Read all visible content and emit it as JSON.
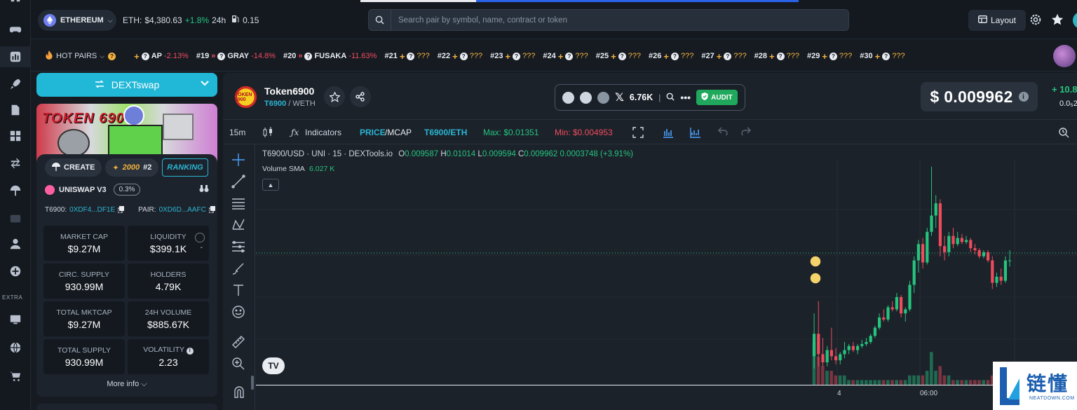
{
  "rail": {
    "extra_label": "EXTRA"
  },
  "topbar": {
    "chain": "ETHEREUM",
    "eth_label": "ETH:",
    "eth_price": "$4,380.63",
    "eth_change": "+1.8%",
    "eth_period": "24h",
    "gas": "0.15",
    "search_placeholder": "Search pair by symbol, name, contract or token",
    "layout_label": "Layout"
  },
  "ticker": {
    "hot_label": "HOT PAIRS",
    "items": [
      {
        "rank": "",
        "symbol": "AP",
        "change": "-2.13%"
      },
      {
        "rank": "#19",
        "symbol": "GRAY",
        "change": "-14.8%"
      },
      {
        "rank": "#20",
        "symbol": "FUSAKA",
        "change": "-11.63%"
      },
      {
        "rank": "#21",
        "symbol": "???",
        "change": ""
      },
      {
        "rank": "#22",
        "symbol": "???",
        "change": ""
      },
      {
        "rank": "#23",
        "symbol": "???",
        "change": ""
      },
      {
        "rank": "#24",
        "symbol": "???",
        "change": ""
      },
      {
        "rank": "#25",
        "symbol": "???",
        "change": ""
      },
      {
        "rank": "#26",
        "symbol": "???",
        "change": ""
      },
      {
        "rank": "#27",
        "symbol": "???",
        "change": ""
      },
      {
        "rank": "#28",
        "symbol": "???",
        "change": ""
      },
      {
        "rank": "#29",
        "symbol": "???",
        "change": ""
      },
      {
        "rank": "#30",
        "symbol": "???",
        "change": ""
      }
    ]
  },
  "left": {
    "swap_label": "DEXTswap",
    "banner_text": "TOKEN 6900",
    "create_label": "CREATE",
    "score": "2000",
    "score_rank": "#2",
    "ranking_label": "RANKING",
    "dex": "UNISWAP V3",
    "fee": "0.3%",
    "token_addr_label": "T6900:",
    "token_addr": "0XDF4...DF1E",
    "pair_addr_label": "PAIR:",
    "pair_addr": "0XD6D...AAFC",
    "stats": [
      {
        "label": "MARKET CAP",
        "value": "$9.27M"
      },
      {
        "label": "LIQUIDITY",
        "value": "$399.1K"
      },
      {
        "label": "CIRC. SUPPLY",
        "value": "930.99M"
      },
      {
        "label": "HOLDERS",
        "value": "4.79K"
      },
      {
        "label": "TOTAL MKTCAP",
        "value": "$9.27M"
      },
      {
        "label": "24H VOLUME",
        "value": "$885.67K"
      },
      {
        "label": "TOTAL SUPPLY",
        "value": "930.99M"
      },
      {
        "label": "VOLATILITY",
        "value": "2.23"
      }
    ],
    "liquidity_extra": "-",
    "more_info": "More info"
  },
  "token": {
    "name": "Token6900",
    "symbol": "T6900",
    "quote": "/ WETH",
    "x_followers": "6.76K",
    "audit_label": "AUDIT",
    "price": "$ 0.009962",
    "change_24h": "+ 10.8",
    "change_sub": "0.0₅2",
    "logo_text": "TOKEN 6900"
  },
  "toolbar": {
    "interval": "15m",
    "indicators": "Indicators",
    "price_label": "PRICE",
    "mcap_label": "/MCAP",
    "pair_label": "T6900/ETH",
    "max_label": "Max: $0.01351",
    "min_label": "Min: $0.004953"
  },
  "legend": {
    "series": "T6900/USD · UNI · 15 · DEXTools.io",
    "o_label": "O",
    "o": "0.009587",
    "h_label": "H",
    "h": "0.01014",
    "l_label": "L",
    "l": "0.009594",
    "c_label": "C",
    "c": "0.009962",
    "change": "0.0003748 (+3.91%)",
    "vol_label": "Volume SMA",
    "vol": "6.027 K"
  },
  "watermark": {
    "cn": "链懂",
    "en": "NEATDOWN.COM"
  },
  "chart_data": {
    "type": "candlestick",
    "x_tick_labels": [
      "4",
      "06:00"
    ],
    "last_price": 0.009962,
    "max": 0.01351,
    "min": 0.004953,
    "candles": [
      {
        "o": 0.0049,
        "h": 0.007,
        "l": 0.0043,
        "c": 0.006
      },
      {
        "o": 0.006,
        "h": 0.0076,
        "l": 0.0044,
        "c": 0.005
      },
      {
        "o": 0.005,
        "h": 0.0058,
        "l": 0.0044,
        "c": 0.0046
      },
      {
        "o": 0.0046,
        "h": 0.0054,
        "l": 0.0044,
        "c": 0.0052
      },
      {
        "o": 0.0052,
        "h": 0.0063,
        "l": 0.0047,
        "c": 0.0049
      },
      {
        "o": 0.0049,
        "h": 0.0053,
        "l": 0.0045,
        "c": 0.0047
      },
      {
        "o": 0.0047,
        "h": 0.0051,
        "l": 0.0045,
        "c": 0.005
      },
      {
        "o": 0.005,
        "h": 0.0056,
        "l": 0.0048,
        "c": 0.0052
      },
      {
        "o": 0.0052,
        "h": 0.0055,
        "l": 0.005,
        "c": 0.0054
      },
      {
        "o": 0.0054,
        "h": 0.0056,
        "l": 0.0051,
        "c": 0.0052
      },
      {
        "o": 0.0052,
        "h": 0.0055,
        "l": 0.005,
        "c": 0.0054
      },
      {
        "o": 0.0054,
        "h": 0.0057,
        "l": 0.0053,
        "c": 0.0055
      },
      {
        "o": 0.0055,
        "h": 0.0058,
        "l": 0.0054,
        "c": 0.0056
      },
      {
        "o": 0.0056,
        "h": 0.006,
        "l": 0.0055,
        "c": 0.0059
      },
      {
        "o": 0.0059,
        "h": 0.0064,
        "l": 0.0058,
        "c": 0.0063
      },
      {
        "o": 0.0063,
        "h": 0.007,
        "l": 0.0062,
        "c": 0.0068
      },
      {
        "o": 0.0068,
        "h": 0.0072,
        "l": 0.0066,
        "c": 0.0067
      },
      {
        "o": 0.0067,
        "h": 0.0074,
        "l": 0.0066,
        "c": 0.0073
      },
      {
        "o": 0.0073,
        "h": 0.0076,
        "l": 0.0071,
        "c": 0.0072
      },
      {
        "o": 0.0072,
        "h": 0.008,
        "l": 0.0071,
        "c": 0.0078
      },
      {
        "o": 0.0078,
        "h": 0.0079,
        "l": 0.0068,
        "c": 0.007
      },
      {
        "o": 0.007,
        "h": 0.0073,
        "l": 0.0066,
        "c": 0.0072
      },
      {
        "o": 0.0072,
        "h": 0.0086,
        "l": 0.0071,
        "c": 0.0084
      },
      {
        "o": 0.0084,
        "h": 0.0098,
        "l": 0.008,
        "c": 0.0096
      },
      {
        "o": 0.0096,
        "h": 0.0106,
        "l": 0.009,
        "c": 0.0104
      },
      {
        "o": 0.0104,
        "h": 0.0107,
        "l": 0.0092,
        "c": 0.0095
      },
      {
        "o": 0.0095,
        "h": 0.0112,
        "l": 0.0094,
        "c": 0.011
      },
      {
        "o": 0.011,
        "h": 0.0142,
        "l": 0.0108,
        "c": 0.0118
      },
      {
        "o": 0.0118,
        "h": 0.0128,
        "l": 0.0112,
        "c": 0.0124
      },
      {
        "o": 0.0124,
        "h": 0.0126,
        "l": 0.0098,
        "c": 0.0103
      },
      {
        "o": 0.0103,
        "h": 0.0108,
        "l": 0.0096,
        "c": 0.01
      },
      {
        "o": 0.01,
        "h": 0.011,
        "l": 0.0098,
        "c": 0.0108
      },
      {
        "o": 0.0108,
        "h": 0.0112,
        "l": 0.0102,
        "c": 0.0104
      },
      {
        "o": 0.0104,
        "h": 0.011,
        "l": 0.0103,
        "c": 0.0107
      },
      {
        "o": 0.0107,
        "h": 0.0109,
        "l": 0.0104,
        "c": 0.0105
      },
      {
        "o": 0.0105,
        "h": 0.0108,
        "l": 0.0104,
        "c": 0.0106
      },
      {
        "o": 0.0106,
        "h": 0.0107,
        "l": 0.01,
        "c": 0.0102
      },
      {
        "o": 0.0102,
        "h": 0.0104,
        "l": 0.0099,
        "c": 0.0101
      },
      {
        "o": 0.0101,
        "h": 0.0102,
        "l": 0.0097,
        "c": 0.0098
      },
      {
        "o": 0.0098,
        "h": 0.0101,
        "l": 0.0097,
        "c": 0.01
      },
      {
        "o": 0.01,
        "h": 0.0101,
        "l": 0.0095,
        "c": 0.0096
      },
      {
        "o": 0.0096,
        "h": 0.0098,
        "l": 0.0082,
        "c": 0.0085
      },
      {
        "o": 0.0085,
        "h": 0.009,
        "l": 0.0083,
        "c": 0.0088
      },
      {
        "o": 0.0088,
        "h": 0.0092,
        "l": 0.0084,
        "c": 0.0086
      },
      {
        "o": 0.0086,
        "h": 0.0098,
        "l": 0.0085,
        "c": 0.0096
      },
      {
        "o": 0.0096,
        "h": 0.0101,
        "l": 0.0093,
        "c": 0.0096
      }
    ],
    "volumes": [
      9,
      6,
      4,
      3,
      3,
      2,
      2,
      2,
      1,
      1,
      1,
      1,
      1,
      1,
      1,
      1,
      1,
      1,
      1,
      1,
      1,
      1,
      2,
      2,
      2,
      2,
      3,
      7,
      3,
      4,
      2,
      2,
      1,
      1,
      1,
      1,
      1,
      1,
      1,
      1,
      1,
      2,
      1,
      1,
      2,
      1
    ]
  }
}
